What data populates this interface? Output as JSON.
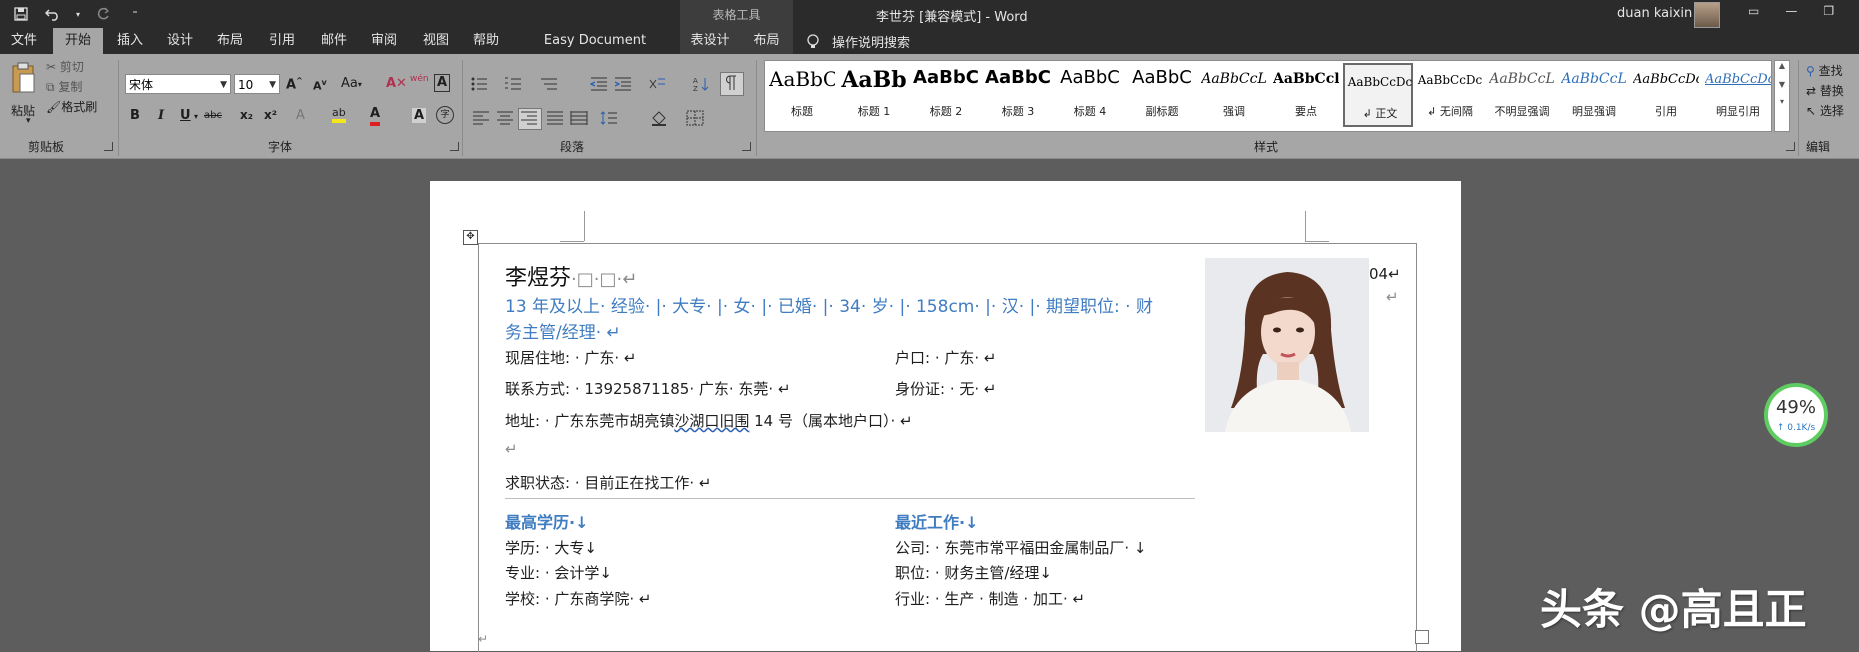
{
  "titlebar": {
    "context_group": "表格工具",
    "title": "李世芬 [兼容模式]  -  Word",
    "user": "duan kaixin"
  },
  "tabs": [
    {
      "label": "文件"
    },
    {
      "label": "开始"
    },
    {
      "label": "插入"
    },
    {
      "label": "设计"
    },
    {
      "label": "布局"
    },
    {
      "label": "引用"
    },
    {
      "label": "邮件"
    },
    {
      "label": "审阅"
    },
    {
      "label": "视图"
    },
    {
      "label": "帮助"
    },
    {
      "label": "Easy Document Creator"
    },
    {
      "label": "表设计"
    },
    {
      "label": "布局"
    }
  ],
  "tell_me": "操作说明搜索",
  "clipboard": {
    "paste": "粘贴",
    "cut": "剪切",
    "copy": "复制",
    "format_painter": "格式刷",
    "label": "剪贴板"
  },
  "font": {
    "font_name": "宋体",
    "font_size": "10",
    "label": "字体",
    "case_label": "Aa",
    "phonetic": "wén",
    "border_char": "A",
    "bold": "B",
    "italic": "I",
    "underline": "U",
    "strike": "abc",
    "subscript": "x₂",
    "superscript": "x²",
    "effects": "A",
    "highlight": "ab",
    "font_color": "A",
    "shading_char": "A",
    "enclose": "字"
  },
  "paragraph": {
    "label": "段落"
  },
  "styles": {
    "label": "样式",
    "items": [
      {
        "sample": "AaBbC",
        "name": "标题"
      },
      {
        "sample": "AaBb",
        "name": "标题 1"
      },
      {
        "sample": "AaBbC",
        "name": "标题 2"
      },
      {
        "sample": "AaBbC",
        "name": "标题 3"
      },
      {
        "sample": "AaBbC",
        "name": "标题 4"
      },
      {
        "sample": "AaBbC",
        "name": "副标题"
      },
      {
        "sample": "AaBbCcL",
        "name": "强调"
      },
      {
        "sample": "AaBbCcl",
        "name": "要点"
      },
      {
        "sample": "AaBbCcDc",
        "name": "↲ 正文"
      },
      {
        "sample": "AaBbCcDc",
        "name": "↲ 无间隔"
      },
      {
        "sample": "AaBbCcL",
        "name": "不明显强调"
      },
      {
        "sample": "AaBbCcL",
        "name": "明显强调"
      },
      {
        "sample": "AaBbCcDc",
        "name": "引用"
      },
      {
        "sample": "AaBbCcDc",
        "name": "明显引用"
      }
    ]
  },
  "editing": {
    "find": "查找",
    "replace": "替换",
    "select": "选择",
    "label": "编辑"
  },
  "document": {
    "name": "李煜芬",
    "name_suffix": "·□·□·↵",
    "headline": "13 年及以上· 经验· |· 大专· |· 女· |· 已婚· |· 34· 岁· |· 158cm· |· 汉· |· 期望职位: · 财",
    "headline2": "务主管/经理· ↵",
    "residence": "现居住地: · 广东· ↵",
    "hukou": "户口: · 广东· ↵",
    "contact": "联系方式: · 13925871185· 广东· 东莞· ↵",
    "id_card": "身份证: · 无· ↵",
    "address_pre": "地址: · 广东东莞市胡亮镇",
    "address_underlined": "沙湖口旧围",
    "address_post": " 14 号（属本地户口）· ↵",
    "blank_mark": "↵",
    "job_status": "求职状态: · 目前正在找工作· ↵",
    "edu_title": "最高学历·↓",
    "work_title": "最近工作·↓",
    "degree": "学历: · 大专↓",
    "major": "专业: · 会计学↓",
    "school": "学校: · 广东商学院· ↵",
    "company": "公司: · 东莞市常平福田金属制品厂· ↓",
    "position": "职位: · 财务主管/经理↓",
    "industry": "行业: · 生产 · 制造 · 加工· ↵",
    "side_number": "04↵",
    "side_mark": "↵",
    "bottom_mark": "↵"
  },
  "progress": {
    "percent": "49%",
    "speed": "↑ 0.1K/s",
    "value": 0.49
  },
  "watermark": {
    "text1": "头条",
    "text2": "@高且正"
  }
}
